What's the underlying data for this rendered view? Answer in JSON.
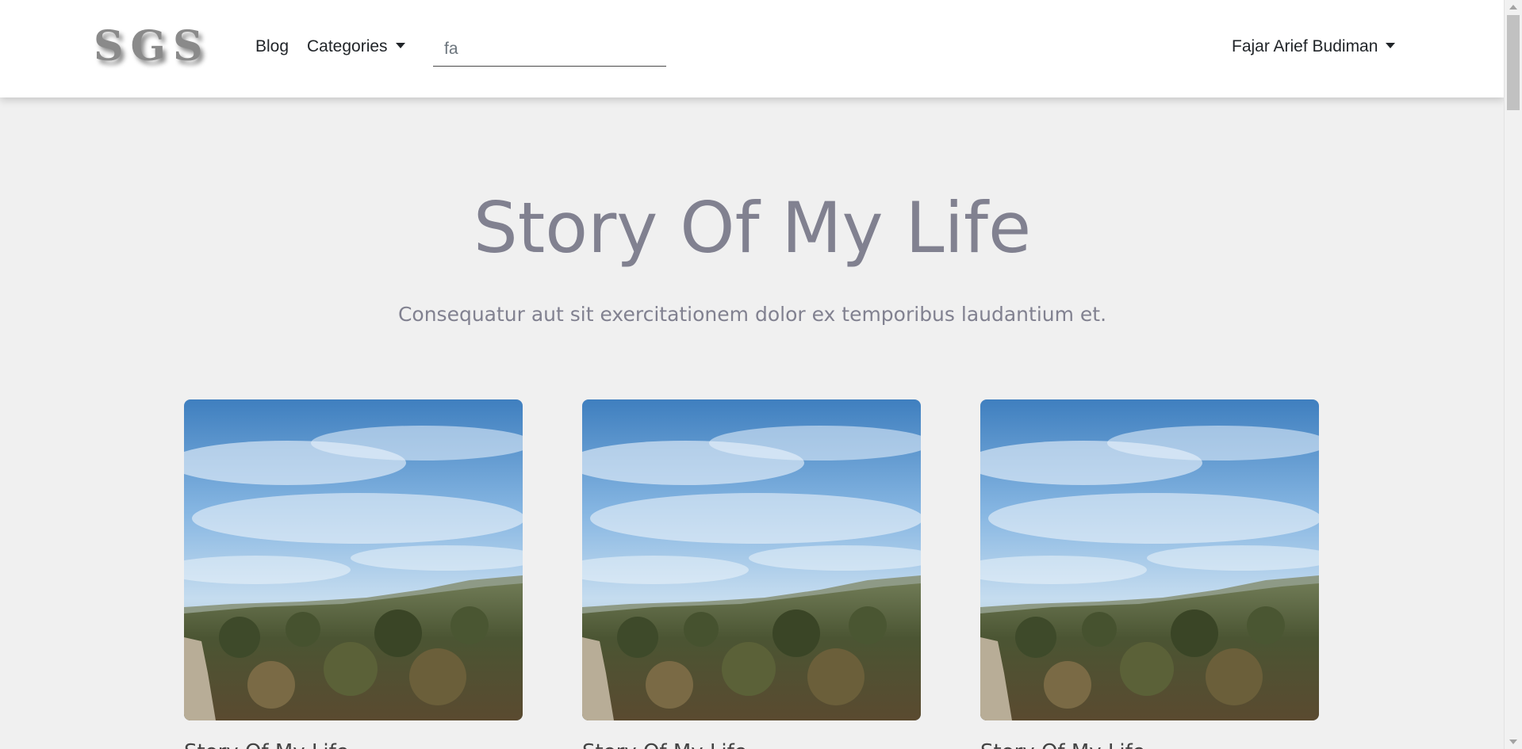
{
  "navbar": {
    "brand": "SGS",
    "links": [
      {
        "label": "Blog"
      },
      {
        "label": "Categories"
      }
    ],
    "search": {
      "value": "fa",
      "placeholder": ""
    },
    "user": {
      "name": "Fajar Arief Budiman"
    }
  },
  "hero": {
    "title": "Story Of My Life",
    "subtitle": "Consequatur aut sit exercitationem dolor ex temporibus laudantium et."
  },
  "cards": [
    {
      "title": "Story Of My Life",
      "image": "landscape-photo"
    },
    {
      "title": "Story Of My Life",
      "image": "landscape-photo"
    },
    {
      "title": "Story Of My Life",
      "image": "landscape-photo"
    }
  ],
  "colors": {
    "background": "#f0f0f0",
    "navbar": "#ffffff",
    "hero_text": "#818190",
    "nav_text": "#212529"
  }
}
